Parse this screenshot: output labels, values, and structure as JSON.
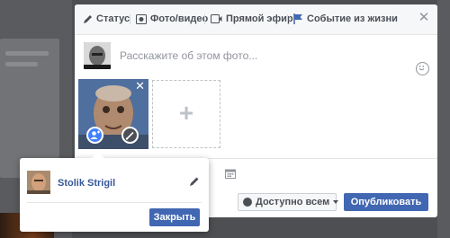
{
  "composer": {
    "tabs": [
      {
        "label": "Статус",
        "icon": "pencil-icon"
      },
      {
        "label": "Фото/видео",
        "icon": "camera-icon"
      },
      {
        "label": "Прямой эфир",
        "icon": "video-camera-icon"
      },
      {
        "label": "Событие из жизни",
        "icon": "flag-icon"
      }
    ],
    "close_icon": "close-icon",
    "input_placeholder": "Расскажите об этом фото...",
    "audience_label": "Доступно всем",
    "publish_label": "Опубликовать"
  },
  "tag_popup": {
    "person_name": "Stolik Strigil",
    "close_label": "Закрыть"
  },
  "colors": {
    "brand_blue": "#4267b2",
    "link_blue": "#365899",
    "overlay": "#4e4f52"
  }
}
